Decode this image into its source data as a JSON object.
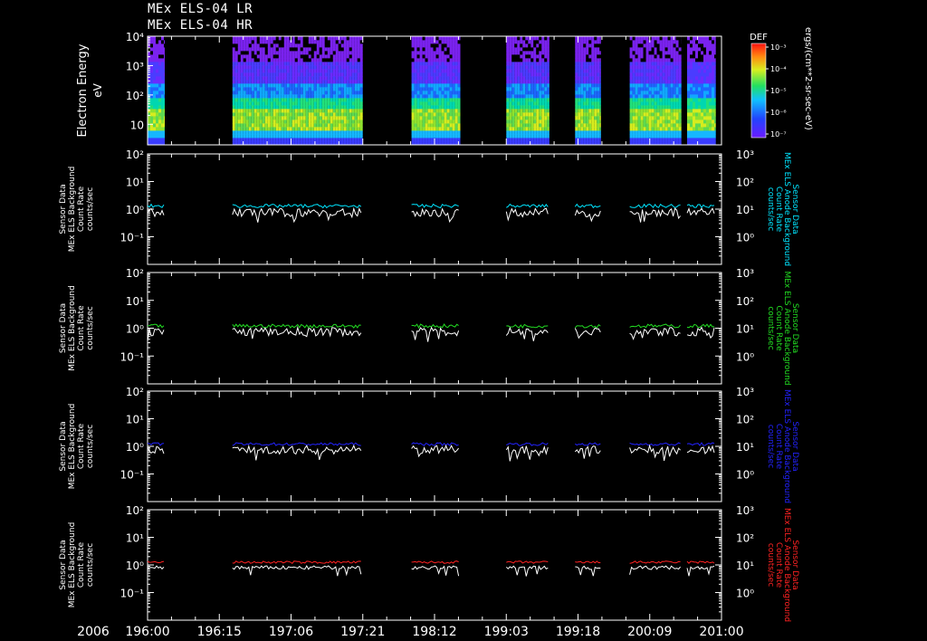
{
  "header": {
    "title_line1": "MEx ELS-04 LR",
    "title_line2": "MEx ELS-04 HR"
  },
  "colors": {
    "background": "#000000",
    "axis": "#ffffff",
    "panel1_right": "#00e5ff",
    "panel2_right": "#22dd22",
    "panel3_right": "#2222ff",
    "panel4_right": "#ff2222",
    "left_trace": "#ffffff"
  },
  "chart_data": [
    {
      "type": "heatmap",
      "ylabel": "Electron Energy",
      "yunit": "eV",
      "yscale": "log",
      "ylim": [
        2,
        10000
      ],
      "yticks": [
        "10",
        "10²",
        "10³",
        "10⁴"
      ],
      "colorbar": {
        "label": "DEF",
        "unit": "ergs/(cm**2-sr-sec-eV)",
        "ticks": [
          "10⁻³",
          "10⁻⁴",
          "10⁻⁵",
          "10⁻⁶",
          "10⁻⁷"
        ]
      },
      "data_intervals": [
        [
          0.0,
          0.03
        ],
        [
          0.148,
          0.375
        ],
        [
          0.46,
          0.545
        ],
        [
          0.625,
          0.7
        ],
        [
          0.745,
          0.79
        ],
        [
          0.84,
          0.93
        ],
        [
          0.94,
          0.99
        ]
      ]
    },
    {
      "type": "line",
      "ylabel_left": [
        "Sensor Data",
        "MEx ELS Background",
        "Count Rate",
        "counts/sec"
      ],
      "ylabel_right": [
        "Sensor Data",
        "MEx ELS Anode Background",
        "Count Rate",
        "counts/sec"
      ],
      "left_ylim": [
        0.01,
        100
      ],
      "right_ylim": [
        0.1,
        1000
      ],
      "left_yticks": [
        "10²",
        "10¹",
        "10⁰",
        "10⁻¹"
      ],
      "right_yticks": [
        "10³",
        "10²",
        "10¹",
        "10⁰"
      ],
      "series": [
        {
          "color": "#00e5ff",
          "level": 1.3,
          "noise": 0.15
        },
        {
          "color": "#ffffff",
          "level": 0.75,
          "noise": 0.35
        }
      ]
    },
    {
      "type": "line",
      "ylabel_left": [
        "Sensor Data",
        "MEx ELS Background",
        "Count Rate",
        "counts/sec"
      ],
      "ylabel_right": [
        "Sensor Data",
        "MEx ELS Anode Background",
        "Count Rate",
        "counts/sec"
      ],
      "left_ylim": [
        0.01,
        100
      ],
      "right_ylim": [
        0.1,
        1000
      ],
      "left_yticks": [
        "10²",
        "10¹",
        "10⁰",
        "10⁻¹"
      ],
      "right_yticks": [
        "10³",
        "10²",
        "10¹",
        "10⁰"
      ],
      "series": [
        {
          "color": "#22dd22",
          "level": 1.2,
          "noise": 0.15
        },
        {
          "color": "#ffffff",
          "level": 0.75,
          "noise": 0.35
        }
      ]
    },
    {
      "type": "line",
      "ylabel_left": [
        "Sensor Data",
        "MEx ELS Background",
        "Count Rate",
        "counts/sec"
      ],
      "ylabel_right": [
        "Sensor Data",
        "MEx ELS Anode Background",
        "Count Rate",
        "counts/sec"
      ],
      "left_ylim": [
        0.01,
        100
      ],
      "right_ylim": [
        0.1,
        1000
      ],
      "left_yticks": [
        "10²",
        "10¹",
        "10⁰",
        "10⁻¹"
      ],
      "right_yticks": [
        "10³",
        "10²",
        "10¹",
        "10⁰"
      ],
      "series": [
        {
          "color": "#2222ff",
          "level": 1.2,
          "noise": 0.12
        },
        {
          "color": "#ffffff",
          "level": 0.75,
          "noise": 0.35
        }
      ]
    },
    {
      "type": "line",
      "ylabel_left": [
        "Sensor Data",
        "MEx ELS Background",
        "Count Rate",
        "counts/sec"
      ],
      "ylabel_right": [
        "Sensor Data",
        "MEx ELS Anode Background",
        "Count Rate",
        "counts/sec"
      ],
      "left_ylim": [
        0.01,
        100
      ],
      "right_ylim": [
        0.1,
        1000
      ],
      "left_yticks": [
        "10²",
        "10¹",
        "10⁰",
        "10⁻¹"
      ],
      "right_yticks": [
        "10³",
        "10²",
        "10¹",
        "10⁰"
      ],
      "series": [
        {
          "color": "#ff2222",
          "level": 1.25,
          "noise": 0.1
        },
        {
          "color": "#ffffff",
          "level": 0.8,
          "noise": 0.15
        }
      ]
    }
  ],
  "x_axis": {
    "year": "2006",
    "tick_labels": [
      "196:00",
      "196:15",
      "197:06",
      "197:21",
      "198:12",
      "199:03",
      "199:18",
      "200:09",
      "201:00"
    ]
  }
}
